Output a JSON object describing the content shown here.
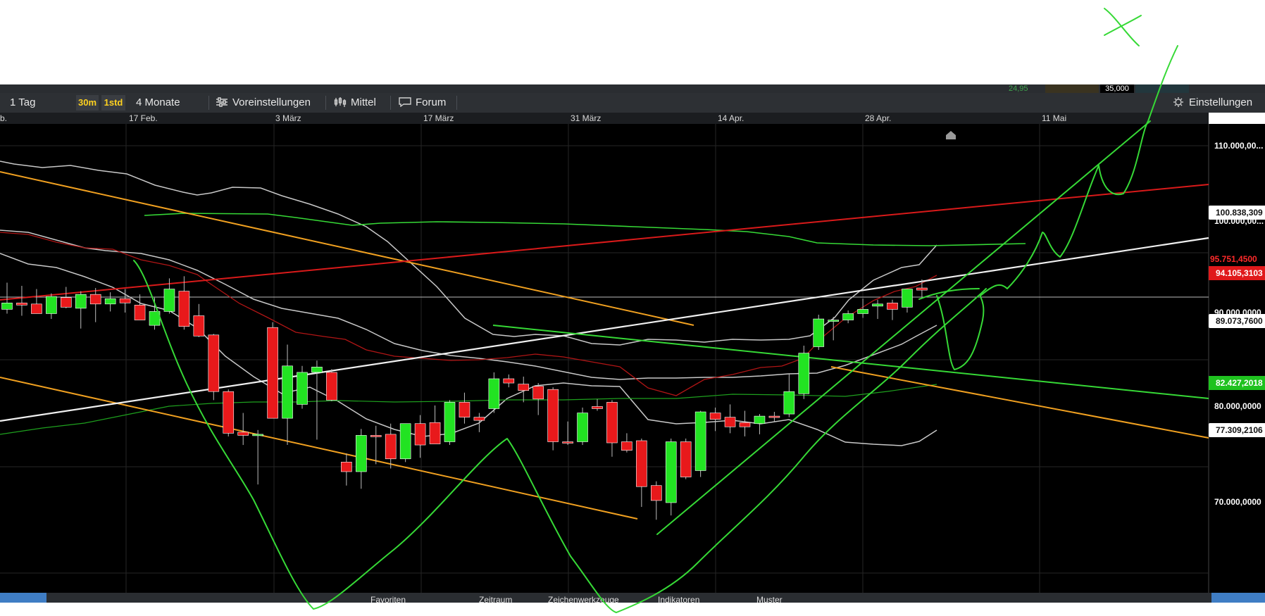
{
  "top_strip": {
    "left_value": "24,95",
    "volume_label": "35,000"
  },
  "toolbar": {
    "range_label": "1 Tag",
    "btn_30m": "30m",
    "btn_1std": "1std",
    "period_label": "4 Monate",
    "presets_label": "Voreinstellungen",
    "average_label": "Mittel",
    "forum_label": "Forum",
    "settings_label": "Einstellungen"
  },
  "date_axis": [
    "b.",
    "17 Feb.",
    "3 März",
    "17 März",
    "31 März",
    "14 Apr.",
    "28 Apr.",
    "11 Mai"
  ],
  "price_axis": [
    "110.000,00...",
    "100.000,00...",
    "90.000,0000",
    "80.000,0000",
    "70.000,0000"
  ],
  "price_markers": {
    "upper_band": "100.838,309",
    "last_price": "95.751,4500",
    "average": "94.105,3103",
    "mid_band": "89.073,7600",
    "green_line": "82.427,2018",
    "lower_band": "77.309,2106"
  },
  "bottom_bar": {
    "favorites": "Favoriten",
    "timeframe": "Zeitraum",
    "drawing_tools": "Zeichenwerkzeuge",
    "indicators": "Indikatoren",
    "patterns": "Muster"
  },
  "colors": {
    "background": "#000000",
    "toolbar": "#2d3034",
    "up_candle": "#22e322",
    "down_candle": "#e8191b",
    "trend_orange": "#f0a020",
    "trend_red": "#d91a1a",
    "trend_white": "#f0f0f0",
    "band_gray": "#c8c8c8",
    "drawing_green": "#36d936",
    "highlight_yellow": "#ffd21f"
  },
  "chart_data": {
    "type": "candlestick",
    "price_range": [
      68000,
      112000
    ],
    "candles": [
      {
        "o": 94700,
        "h": 97200,
        "l": 94300,
        "c": 95300
      },
      {
        "o": 95300,
        "h": 96900,
        "l": 94100,
        "c": 95100
      },
      {
        "o": 95200,
        "h": 96600,
        "l": 94300,
        "c": 94300
      },
      {
        "o": 94300,
        "h": 96200,
        "l": 93800,
        "c": 95900
      },
      {
        "o": 95800,
        "h": 96800,
        "l": 94800,
        "c": 94900
      },
      {
        "o": 94800,
        "h": 96400,
        "l": 92900,
        "c": 96100
      },
      {
        "o": 96100,
        "h": 96700,
        "l": 93500,
        "c": 95200
      },
      {
        "o": 95200,
        "h": 96300,
        "l": 94500,
        "c": 95700
      },
      {
        "o": 95700,
        "h": 96600,
        "l": 94400,
        "c": 95300
      },
      {
        "o": 95100,
        "h": 96100,
        "l": 93800,
        "c": 93700
      },
      {
        "o": 93200,
        "h": 95800,
        "l": 92800,
        "c": 94500
      },
      {
        "o": 94500,
        "h": 97600,
        "l": 94300,
        "c": 96600
      },
      {
        "o": 96400,
        "h": 97800,
        "l": 92800,
        "c": 93100
      },
      {
        "o": 94100,
        "h": 95200,
        "l": 92100,
        "c": 92200
      },
      {
        "o": 92300,
        "h": 92400,
        "l": 86200,
        "c": 87000
      },
      {
        "o": 87000,
        "h": 87200,
        "l": 82800,
        "c": 83100
      },
      {
        "o": 83200,
        "h": 85000,
        "l": 82000,
        "c": 82900
      },
      {
        "o": 83000,
        "h": 83400,
        "l": 78300,
        "c": 83000
      },
      {
        "o": 93000,
        "h": 93500,
        "l": 85000,
        "c": 84500
      },
      {
        "o": 84500,
        "h": 91400,
        "l": 82000,
        "c": 89400
      },
      {
        "o": 85800,
        "h": 89400,
        "l": 85400,
        "c": 88800
      },
      {
        "o": 88800,
        "h": 89900,
        "l": 82500,
        "c": 89300
      },
      {
        "o": 88800,
        "h": 89100,
        "l": 86100,
        "c": 86200
      },
      {
        "o": 80400,
        "h": 81200,
        "l": 78200,
        "c": 79500
      },
      {
        "o": 79500,
        "h": 83500,
        "l": 77900,
        "c": 82900
      },
      {
        "o": 82900,
        "h": 83800,
        "l": 80200,
        "c": 82800
      },
      {
        "o": 83000,
        "h": 84000,
        "l": 79800,
        "c": 80700
      },
      {
        "o": 80700,
        "h": 83700,
        "l": 80400,
        "c": 84000
      },
      {
        "o": 84000,
        "h": 84800,
        "l": 80800,
        "c": 82000
      },
      {
        "o": 84100,
        "h": 85700,
        "l": 82900,
        "c": 82100
      },
      {
        "o": 82300,
        "h": 86200,
        "l": 82000,
        "c": 86000
      },
      {
        "o": 86000,
        "h": 86900,
        "l": 84000,
        "c": 84600
      },
      {
        "o": 84600,
        "h": 85000,
        "l": 83200,
        "c": 84300
      },
      {
        "o": 85400,
        "h": 88800,
        "l": 85000,
        "c": 88200
      },
      {
        "o": 88200,
        "h": 88600,
        "l": 87400,
        "c": 87800
      },
      {
        "o": 87700,
        "h": 88400,
        "l": 86000,
        "c": 87100
      },
      {
        "o": 87500,
        "h": 87800,
        "l": 84800,
        "c": 86300
      },
      {
        "o": 87200,
        "h": 87400,
        "l": 81500,
        "c": 82300
      },
      {
        "o": 82300,
        "h": 84200,
        "l": 82000,
        "c": 82200
      },
      {
        "o": 82300,
        "h": 85500,
        "l": 82000,
        "c": 85000
      },
      {
        "o": 85600,
        "h": 86300,
        "l": 85200,
        "c": 85400
      },
      {
        "o": 86000,
        "h": 86200,
        "l": 80900,
        "c": 82200
      },
      {
        "o": 82300,
        "h": 83100,
        "l": 81300,
        "c": 81500
      },
      {
        "o": 82400,
        "h": 82600,
        "l": 76200,
        "c": 78100
      },
      {
        "o": 78200,
        "h": 78600,
        "l": 75000,
        "c": 76800
      },
      {
        "o": 76600,
        "h": 82600,
        "l": 75400,
        "c": 82300
      },
      {
        "o": 82300,
        "h": 82600,
        "l": 78800,
        "c": 79000
      },
      {
        "o": 79600,
        "h": 85200,
        "l": 79000,
        "c": 85100
      },
      {
        "o": 85000,
        "h": 85500,
        "l": 83300,
        "c": 84400
      },
      {
        "o": 84600,
        "h": 85800,
        "l": 83100,
        "c": 83700
      },
      {
        "o": 84100,
        "h": 85200,
        "l": 82800,
        "c": 83700
      },
      {
        "o": 84000,
        "h": 84900,
        "l": 83000,
        "c": 84700
      },
      {
        "o": 84700,
        "h": 85100,
        "l": 84200,
        "c": 84600
      },
      {
        "o": 84900,
        "h": 88700,
        "l": 84600,
        "c": 87000
      },
      {
        "o": 86800,
        "h": 91300,
        "l": 86300,
        "c": 90600
      },
      {
        "o": 91200,
        "h": 94200,
        "l": 90900,
        "c": 93800
      },
      {
        "o": 93700,
        "h": 94000,
        "l": 91800,
        "c": 93700
      },
      {
        "o": 93700,
        "h": 94600,
        "l": 93400,
        "c": 94300
      },
      {
        "o": 94300,
        "h": 95700,
        "l": 93900,
        "c": 94700
      },
      {
        "o": 95000,
        "h": 95600,
        "l": 93800,
        "c": 95200
      },
      {
        "o": 95300,
        "h": 95600,
        "l": 93700,
        "c": 94700
      },
      {
        "o": 94900,
        "h": 96500,
        "l": 94400,
        "c": 96600
      },
      {
        "o": 96700,
        "h": 97500,
        "l": 95800,
        "c": 96500
      }
    ]
  }
}
